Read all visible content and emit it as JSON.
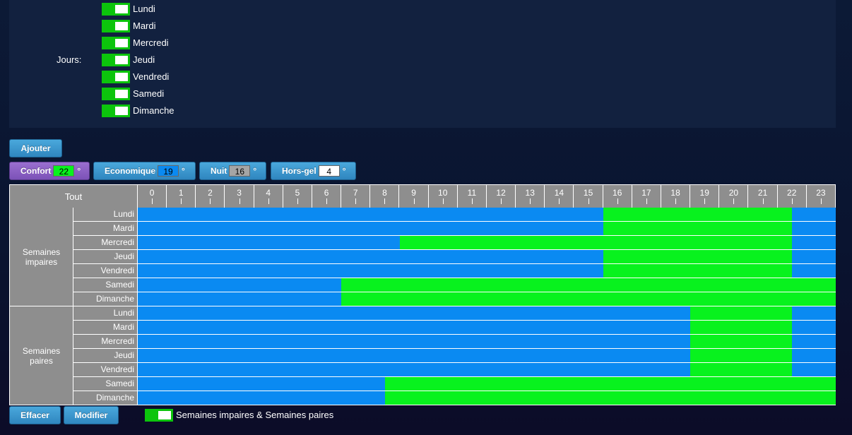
{
  "days_panel": {
    "label": "Jours:",
    "days": [
      {
        "name": "Lundi",
        "on": true
      },
      {
        "name": "Mardi",
        "on": true
      },
      {
        "name": "Mercredi",
        "on": true
      },
      {
        "name": "Jeudi",
        "on": true
      },
      {
        "name": "Vendredi",
        "on": true
      },
      {
        "name": "Samedi",
        "on": true
      },
      {
        "name": "Dimanche",
        "on": true
      }
    ]
  },
  "actions": {
    "add_label": "Ajouter",
    "clear_label": "Effacer",
    "modify_label": "Modifier"
  },
  "modes": [
    {
      "label": "Confort",
      "value": "22",
      "unit": "°",
      "color": "#08f21e",
      "active": true
    },
    {
      "label": "Economique",
      "value": "19",
      "unit": "°",
      "color": "#0a8af2",
      "active": false
    },
    {
      "label": "Nuit",
      "value": "16",
      "unit": "°",
      "color": "#a5a5a5",
      "active": false
    },
    {
      "label": "Hors-gel",
      "value": "4",
      "unit": "°",
      "color": "#ffffff",
      "active": false
    }
  ],
  "schedule": {
    "all_label": "Tout",
    "hours": [
      "0",
      "1",
      "2",
      "3",
      "4",
      "5",
      "6",
      "7",
      "8",
      "9",
      "10",
      "11",
      "12",
      "13",
      "14",
      "15",
      "16",
      "17",
      "18",
      "19",
      "20",
      "21",
      "22",
      "23"
    ],
    "colors": {
      "confort": "#08f21e",
      "economique": "#0a8af2"
    },
    "groups": [
      {
        "label": "Semaines impaires",
        "rows": [
          {
            "day": "Lundi",
            "confort": [
              16.0,
              22.5
            ]
          },
          {
            "day": "Mardi",
            "confort": [
              16.0,
              22.5
            ]
          },
          {
            "day": "Mercredi",
            "confort": [
              9.0,
              22.5
            ]
          },
          {
            "day": "Jeudi",
            "confort": [
              16.0,
              22.5
            ]
          },
          {
            "day": "Vendredi",
            "confort": [
              16.0,
              22.5
            ]
          },
          {
            "day": "Samedi",
            "confort": [
              7.0,
              24.0
            ]
          },
          {
            "day": "Dimanche",
            "confort": [
              7.0,
              24.0
            ]
          }
        ]
      },
      {
        "label": "Semaines paires",
        "rows": [
          {
            "day": "Lundi",
            "confort": [
              19.0,
              22.5
            ]
          },
          {
            "day": "Mardi",
            "confort": [
              19.0,
              22.5
            ]
          },
          {
            "day": "Mercredi",
            "confort": [
              19.0,
              22.5
            ]
          },
          {
            "day": "Jeudi",
            "confort": [
              19.0,
              22.5
            ]
          },
          {
            "day": "Vendredi",
            "confort": [
              19.0,
              22.5
            ]
          },
          {
            "day": "Samedi",
            "confort": [
              8.5,
              24.0
            ]
          },
          {
            "day": "Dimanche",
            "confort": [
              8.5,
              24.0
            ]
          }
        ]
      }
    ]
  },
  "weeks_toggle": {
    "label": "Semaines impaires & Semaines paires",
    "on": true
  }
}
